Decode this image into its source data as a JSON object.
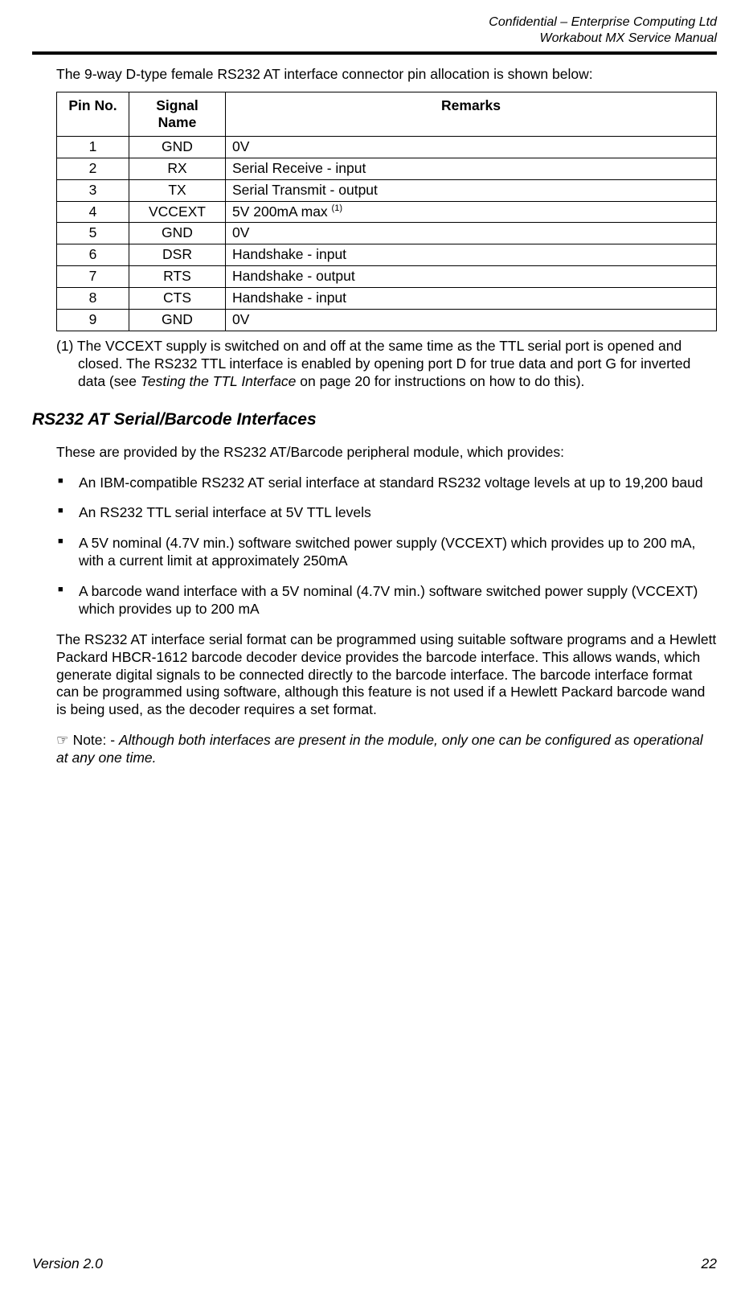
{
  "header": {
    "line1": "Confidential – Enterprise Computing Ltd",
    "line2": "Workabout MX Service Manual"
  },
  "intro": "The 9-way D-type female RS232 AT interface connector pin allocation is shown below:",
  "table": {
    "headers": {
      "pin": "Pin No.",
      "signal": "Signal Name",
      "remarks": "Remarks"
    },
    "rows": [
      {
        "pin": "1",
        "signal": "GND",
        "remarks": "0V"
      },
      {
        "pin": "2",
        "signal": "RX",
        "remarks": "Serial Receive - input"
      },
      {
        "pin": "3",
        "signal": "TX",
        "remarks": "Serial Transmit - output"
      },
      {
        "pin": "4",
        "signal": "VCCEXT",
        "remarks": "5V 200mA max ",
        "sup": "(1)"
      },
      {
        "pin": "5",
        "signal": "GND",
        "remarks": "0V"
      },
      {
        "pin": "6",
        "signal": "DSR",
        "remarks": "Handshake - input"
      },
      {
        "pin": "7",
        "signal": "RTS",
        "remarks": "Handshake - output"
      },
      {
        "pin": "8",
        "signal": "CTS",
        "remarks": "Handshake - input"
      },
      {
        "pin": "9",
        "signal": "GND",
        "remarks": "0V"
      }
    ]
  },
  "footnote": {
    "pre": "(1) The VCCEXT supply is switched on and off at the same time as the TTL serial port is opened and closed. The RS232 TTL interface is enabled by opening port D for true data and port G for inverted data (see ",
    "ital": "Testing the TTL Interface",
    "post": " on page 20 for instructions on how to do this)."
  },
  "section": {
    "title": "RS232 AT Serial/Barcode Interfaces",
    "lead": "These are provided by the RS232 AT/Barcode peripheral module, which provides:",
    "bullets": [
      "An IBM-compatible RS232 AT serial interface at standard RS232 voltage levels at up to 19,200 baud",
      "An RS232 TTL serial interface at 5V TTL levels",
      "A 5V nominal (4.7V min.) software switched power supply (VCCEXT) which provides up to 200 mA, with a current limit at approximately 250mA",
      "A barcode wand interface with a 5V nominal (4.7V min.) software switched power supply (VCCEXT) which provides up to 200 mA"
    ],
    "body": "The RS232 AT interface serial format can be programmed using suitable software programs and a Hewlett Packard HBCR-1612 barcode decoder device provides the barcode interface. This allows wands, which generate digital signals to be connected directly to the barcode interface. The barcode interface format can be programmed using software, although this feature is not used if a Hewlett Packard barcode wand is being used, as the decoder requires a set format.",
    "note": {
      "icon": "☞",
      "label": " Note: - ",
      "text": "Although both interfaces are present in the module, only one can be configured as operational at any one time."
    }
  },
  "footer": {
    "version": "Version 2.0",
    "page": "22"
  }
}
